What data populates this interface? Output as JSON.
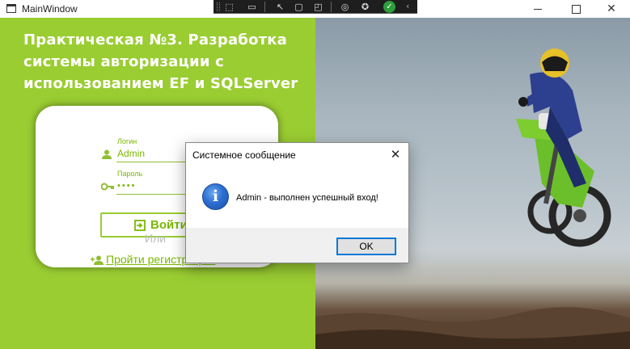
{
  "window": {
    "title": "MainWindow",
    "controls": [
      "minimize-icon",
      "maximize-icon",
      "close-icon"
    ]
  },
  "debug_toolbar": {
    "icons": [
      "select-element-icon",
      "live-preview-icon",
      "display-layout-adorners-icon",
      "track-focused-element-icon",
      "hot-reload-icon",
      "accessibility-icon",
      "check-icon"
    ]
  },
  "app": {
    "heading": "Практическая  №3. Разработка системы авторизации с использованием EF и SQLServer",
    "login_form": {
      "login_label": "Логин",
      "login_value": "Admin",
      "password_label": "Пароль",
      "password_value": "••••",
      "login_button": "Войти",
      "or_text": "Или",
      "register_link": "Пройти регистрацию"
    },
    "background_image": "motocross-rider-photo"
  },
  "dialog": {
    "title": "Системное сообщение",
    "message": "Admin - выполнен успешный вход!",
    "ok_button": "OK",
    "icon": "info-icon"
  },
  "colors": {
    "accent": "#9acd32",
    "accent_text": "#7ab800",
    "dialog_border": "#0078d7"
  }
}
